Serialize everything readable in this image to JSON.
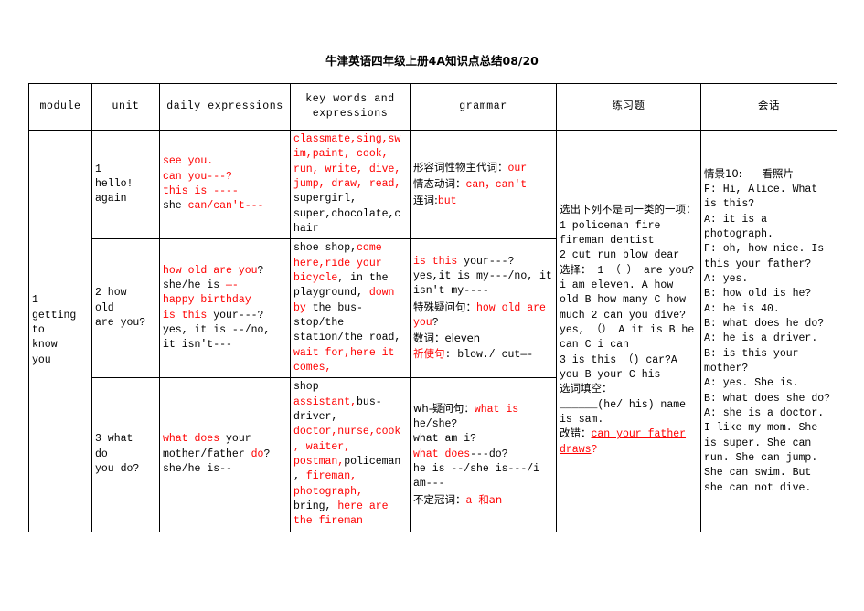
{
  "document": {
    "title": "牛津英语四年级上册4A知识点总结08/20"
  },
  "table": {
    "headers": {
      "module": "module",
      "unit": "unit",
      "daily": "daily expressions",
      "keywords_line1": "key words and",
      "keywords_line2": "expressions",
      "grammar": "grammar",
      "practice": "练习题",
      "dialogue": "会话"
    },
    "module": {
      "label_line1": "1",
      "label_line2": "getting",
      "label_line3": "to",
      "label_line4": "know",
      "label_line5": "you"
    },
    "rows": [
      {
        "unit_line1": "1",
        "unit_line2": "hello!",
        "unit_line3": "again",
        "daily": {
          "l1_red": "see you.",
          "l2_red": "can you---?",
          "l3_red": "this is ----",
          "l4_black": "she ",
          "l4_red": "can/can't---"
        },
        "keywords": {
          "red_part": "classmate,sing,swim,paint, cook, run, write, dive, jump, draw, read, ",
          "black_part": "supergirl, super,chocolate,chair"
        },
        "grammar": {
          "l1_label": "形容词性物主代词：",
          "l1_red": "our",
          "l2_label": "情态动词：",
          "l2_red": "can，can't",
          "l3_label": "连词:",
          "l3_red": "but"
        }
      },
      {
        "unit_line1": "2      how",
        "unit_line2": "old",
        "unit_line3": "are you?",
        "daily": {
          "l1_red": "how old are you",
          "l1_black": "?",
          "l2_black": "she/he is ",
          "l2_red": "—-",
          "l3_red": "happy birthday",
          "l4_red": "is this ",
          "l4_black": "your---?",
          "l5_black": "yes, it is --/no, it isn't---"
        },
        "keywords": {
          "seg1_black": "shoe shop,",
          "seg2_red": "come here,",
          "seg3_red": "ride your bicycle",
          "seg4_black": ", in the playground, ",
          "seg5_red": "down by ",
          "seg6_black": "the bus-stop/the station/the road, ",
          "seg7_red": "wait for,",
          "seg8_red": "here it comes,"
        },
        "grammar": {
          "l1_red": "is this ",
          "l1_black": "your---?",
          "l2_black": "yes,it is my---/no, it isn't my----",
          "l3_label": "特殊疑问句：",
          "l3_red": "how old are you",
          "l3_black": "?",
          "l4_label": "数词：eleven",
          "l5_label_red": "祈使句",
          "l5_black": ": blow./ cut—-"
        }
      },
      {
        "unit_line1": "3     what",
        "unit_line2": "do",
        "unit_line3": " you do?",
        "daily": {
          "l1_red": "what does ",
          "l1_black": "your mother/father ",
          "l1b_red": "do",
          "l1c_black": "?",
          "l2_black": "she/he is--"
        },
        "keywords": {
          "seg1_black": "shop ",
          "seg2_red": "assistant,",
          "seg3_black": "bus-driver, ",
          "seg4_red": "doctor,nurse,cook, waiter, postman,",
          "seg5_black": "policeman, ",
          "seg6_red": "fireman, photograph, ",
          "seg7_black": "bring, ",
          "seg8_red": "here are the fireman"
        },
        "grammar": {
          "l1_label": "wh-疑问句：",
          "l1_red": "what is",
          "l1_black": " he/she?",
          "l2_black": "what am i?",
          "l3_red": "what does",
          "l3_black": "---do?",
          "l4_black": "he is --/she is---/i am---",
          "l5_label": "不定冠词：",
          "l5_red": "a ",
          "l5_cjk_red": "和an"
        }
      }
    ],
    "practice": {
      "line1": "选出下列不是同一类的一项：1  policeman fire fireman dentist",
      "line2": "  2 cut run blow dear",
      "line3": "  选择： 1   （ ） are you? i am eleven. A how old  B how many  C  how much      2 can you dive?   yes, （） A it is   B he can  C i can",
      "line4": " 3 is this （) car?A you  B  your   C  his",
      "line5": "选词填空：",
      "line6": "______(he/ his) name is sam.",
      "line7_label": "改错：",
      "line7_underlined": "can your father draws",
      "line7_end": "?"
    },
    "dialogue": {
      "scene_label": "情景10:",
      "scene_title": "看照片",
      "lines": [
        "F: Hi, Alice. What is this?",
        "A: it is a photograph.",
        "F: oh, how nice. Is this your father?",
        "A: yes.",
        "B: how old is he?",
        "A: he is 40.",
        "B: what does he do?",
        "A: he is a driver.",
        "B: is this your mother?",
        "A: yes. She is.",
        "B: what does she do?",
        "A: she is a doctor. I like my mom. She is super. She can run. She can jump. She can swim. But she can not dive."
      ]
    }
  },
  "colors": {
    "highlight": "#ff0000",
    "text": "#000000",
    "border": "#000000",
    "background": "#ffffff"
  }
}
